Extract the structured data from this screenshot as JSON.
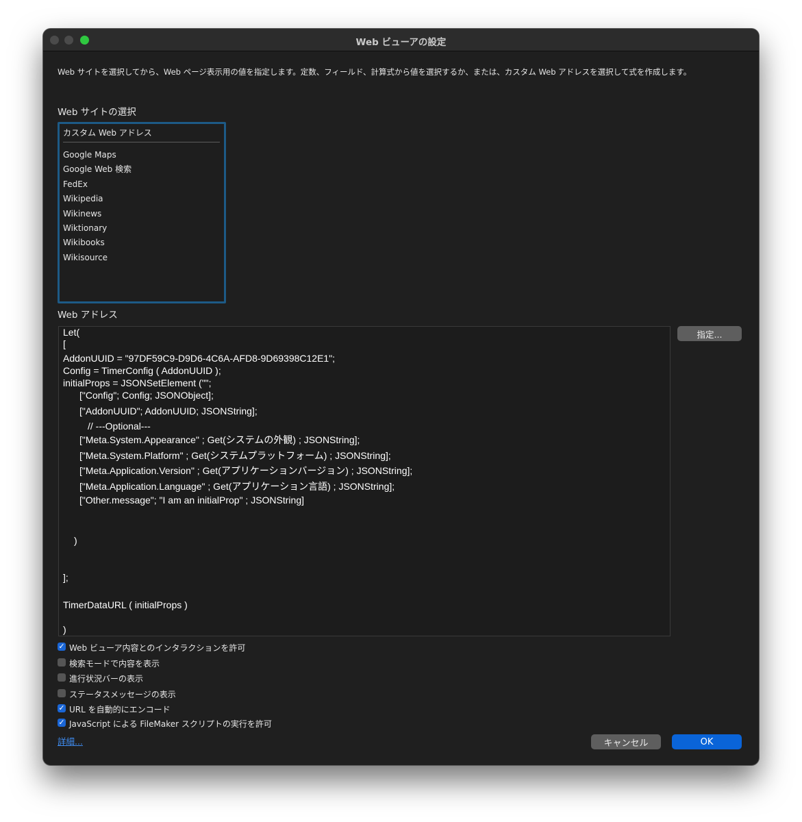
{
  "window": {
    "title": "Web ビューアの設定"
  },
  "description": "Web サイトを選択してから、Web ページ表示用の値を指定します。定数、フィールド、計算式から値を選択するか、または、カスタム Web アドレスを選択して式を作成します。",
  "site_section": {
    "label": "Web サイトの選択",
    "custom_option": "カスタム Web アドレス",
    "items": [
      "Google Maps",
      "Google Web 検索",
      "FedEx",
      "Wikipedia",
      "Wikinews",
      "Wiktionary",
      "Wikibooks",
      "Wikisource"
    ]
  },
  "address_section": {
    "label": "Web アドレス",
    "specify_button": "指定...",
    "code_lines": [
      "Let(",
      "[",
      "AddonUUID = \"97DF59C9-D9D6-4C6A-AFD8-9D69398C12E1\";",
      "Config = TimerConfig ( AddonUUID );",
      "initialProps = JSONSetElement (\"\";",
      "[\"Config\"; Config; JSONObject];",
      "[\"AddonUUID\"; AddonUUID; JSONString];",
      "// ---Optional---",
      "[\"Meta.System.Appearance\" ; Get(システムの外観) ; JSONString];",
      "[\"Meta.System.Platform\" ; Get(システムプラットフォーム) ; JSONString];",
      "[\"Meta.Application.Version\" ; Get(アプリケーションバージョン) ; JSONString];",
      "[\"Meta.Application.Language\" ; Get(アプリケーション言語) ; JSONString];",
      "[\"Other.message\"; \"I am an initialProp\" ; JSONString]",
      ")",
      "];",
      "TimerDataURL ( initialProps )",
      ")"
    ]
  },
  "options": [
    {
      "label": "Web ビューア内容とのインタラクションを許可",
      "checked": true
    },
    {
      "label": "検索モードで内容を表示",
      "checked": false
    },
    {
      "label": "進行状況バーの表示",
      "checked": false
    },
    {
      "label": "ステータスメッセージの表示",
      "checked": false
    },
    {
      "label": "URL を自動的にエンコード",
      "checked": true
    },
    {
      "label": "JavaScript による FileMaker スクリプトの実行を許可",
      "checked": true
    }
  ],
  "footer": {
    "details_link": "詳細...",
    "cancel_button": "キャンセル",
    "ok_button": "OK"
  },
  "colors": {
    "accent": "#0a64d8",
    "window_bg": "#1f1f1f",
    "focus_ring": "#1d5a86"
  }
}
